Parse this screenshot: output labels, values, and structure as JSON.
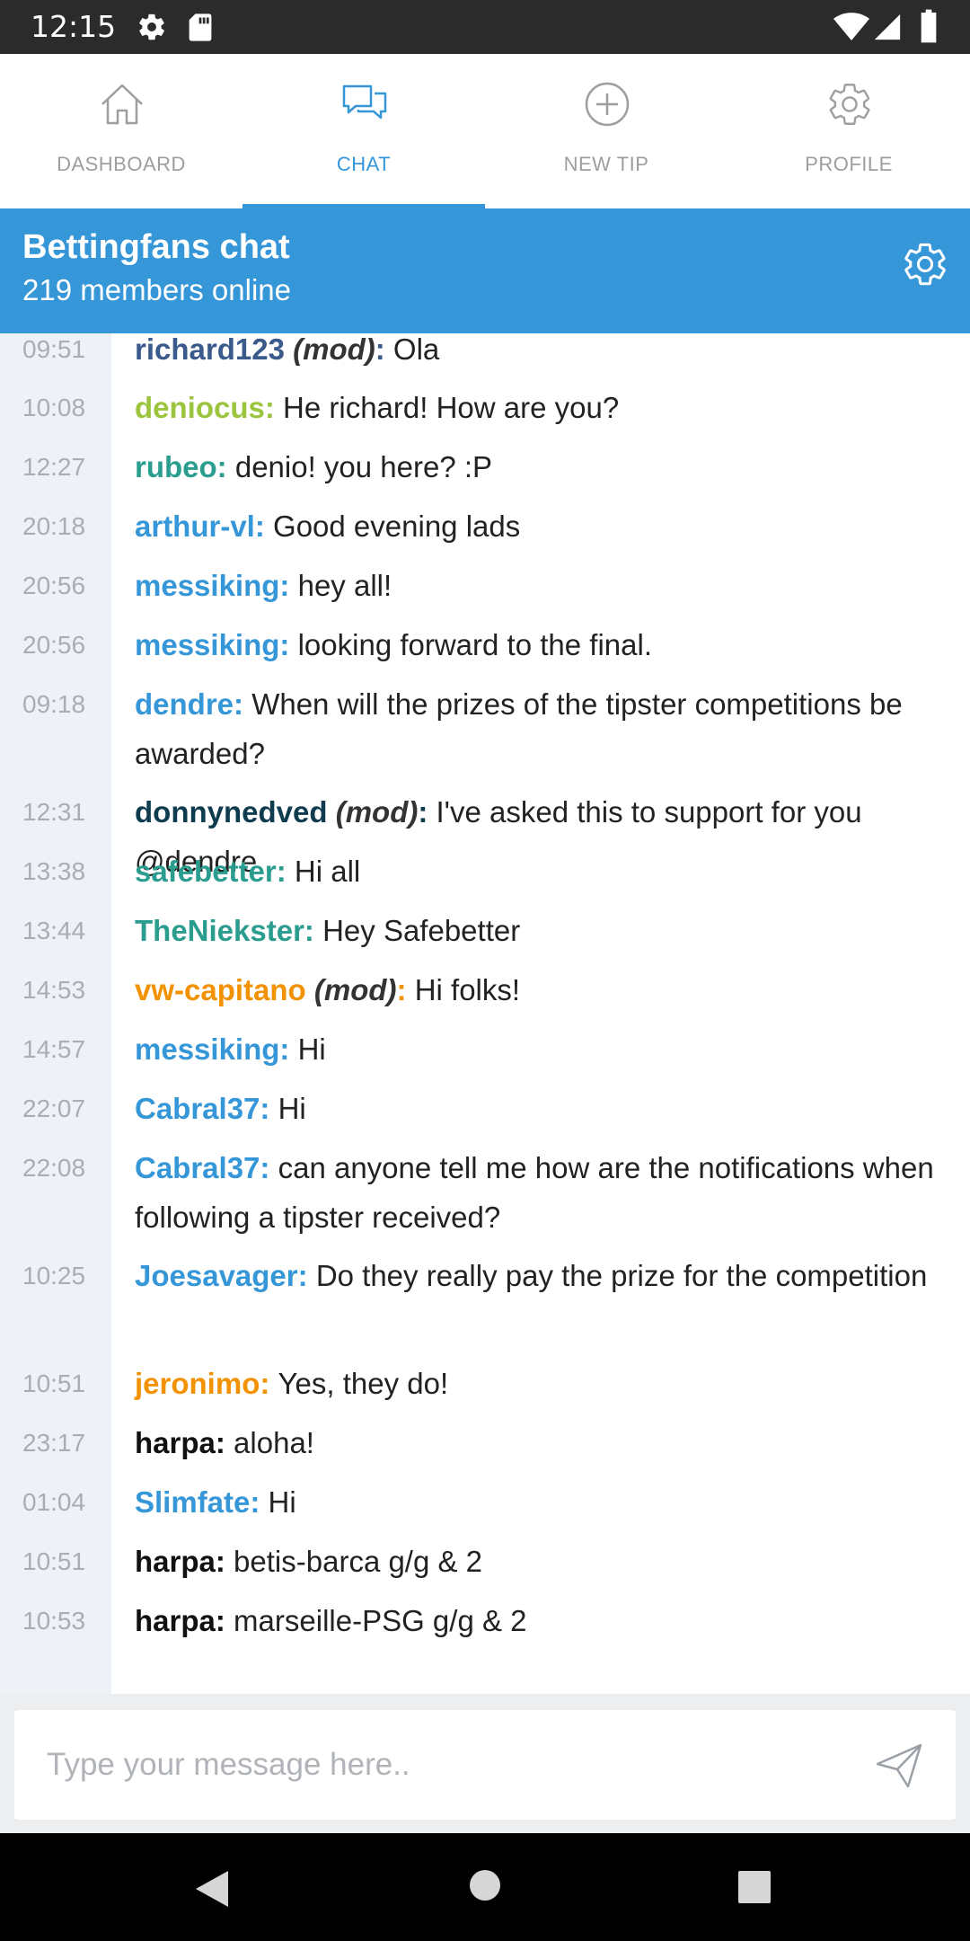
{
  "status_bar": {
    "time": "12:15"
  },
  "tabs": [
    {
      "label": "DASHBOARD",
      "icon": "home-icon",
      "active": false
    },
    {
      "label": "CHAT",
      "icon": "chat-icon",
      "active": true
    },
    {
      "label": "NEW TIP",
      "icon": "plus-circle-icon",
      "active": false
    },
    {
      "label": "PROFILE",
      "icon": "gear-icon",
      "active": false
    }
  ],
  "header": {
    "title": "Bettingfans chat",
    "subtitle": "219 members online"
  },
  "mod_label": "(mod)",
  "messages": [
    {
      "time": "09:51",
      "user": "richard123",
      "mod": true,
      "text": "Ola",
      "color": "#3a5a8c"
    },
    {
      "time": "10:08",
      "user": "deniocus",
      "mod": false,
      "text": "He richard! How are you?",
      "color": "#9bc53d"
    },
    {
      "time": "12:27",
      "user": "rubeo",
      "mod": false,
      "text": "denio! you here? :P",
      "color": "#2a9d8f"
    },
    {
      "time": "20:18",
      "user": "arthur-vl",
      "mod": false,
      "text": "Good evening lads",
      "color": "#3596d8"
    },
    {
      "time": "20:56",
      "user": "messiking",
      "mod": false,
      "text": "hey all!",
      "color": "#3596d8"
    },
    {
      "time": "20:56",
      "user": "messiking",
      "mod": false,
      "text": "looking forward to the final.",
      "color": "#3596d8"
    },
    {
      "time": "09:18",
      "user": "dendre",
      "mod": false,
      "text": "When will the prizes of the tipster competitions be awarded?",
      "color": "#3596d8"
    },
    {
      "time": "12:31",
      "user": "donnynedved",
      "mod": true,
      "text": "I've asked this to support for you @dendre",
      "color": "#0f3b4f"
    },
    {
      "time": "13:38",
      "user": "safebetter",
      "mod": false,
      "text": "Hi all",
      "color": "#2a9d8f"
    },
    {
      "time": "13:44",
      "user": "TheNiekster",
      "mod": false,
      "text": "Hey Safebetter",
      "color": "#2a9d8f"
    },
    {
      "time": "14:53",
      "user": "vw-capitano",
      "mod": true,
      "text": "Hi folks!",
      "color": "#f39200"
    },
    {
      "time": "14:57",
      "user": "messiking",
      "mod": false,
      "text": "Hi",
      "color": "#3596d8"
    },
    {
      "time": "22:07",
      "user": "Cabral37",
      "mod": false,
      "text": "Hi",
      "color": "#3596d8"
    },
    {
      "time": "22:08",
      "user": "Cabral37",
      "mod": false,
      "text": "can anyone tell me how are the notifications when following a tipster received?",
      "color": "#3596d8"
    },
    {
      "time": "10:25",
      "user": "Joesavager",
      "mod": false,
      "text": "Do they  really pay the prize for the competition",
      "color": "#3596d8"
    },
    {
      "time": "10:51",
      "user": "jeronimo",
      "mod": false,
      "text": "Yes, they do!",
      "color": "#f39200"
    },
    {
      "time": "23:17",
      "user": "harpa",
      "mod": false,
      "text": "aloha!",
      "color": "#111111"
    },
    {
      "time": "01:04",
      "user": "Slimfate",
      "mod": false,
      "text": "Hi",
      "color": "#3596d8"
    },
    {
      "time": "10:51",
      "user": "harpa",
      "mod": false,
      "text": "betis-barca g/g & 2",
      "color": "#111111"
    },
    {
      "time": "10:53",
      "user": "harpa",
      "mod": false,
      "text": "marseille-PSG g/g & 2",
      "color": "#111111"
    }
  ],
  "input": {
    "placeholder": "Type your message here..",
    "value": ""
  },
  "colors": {
    "accent": "#3596d8",
    "inactive_tab": "#9e9e9e"
  }
}
